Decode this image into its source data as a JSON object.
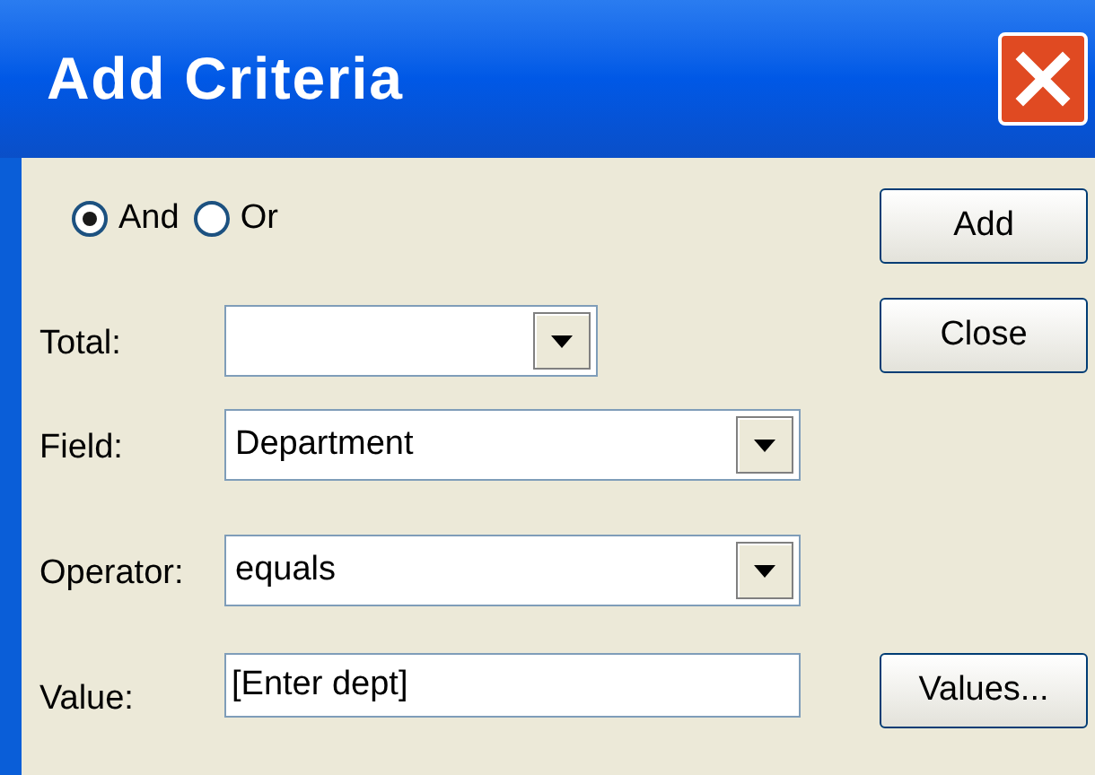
{
  "window": {
    "title": "Add Criteria"
  },
  "logic": [
    {
      "label": "And",
      "selected": true
    },
    {
      "label": "Or",
      "selected": false
    }
  ],
  "fields": [
    {
      "kind": "short-combo",
      "label": "Total:"
    },
    {
      "kind": "combo",
      "label": "Field:",
      "value": "Department"
    },
    {
      "kind": "combo",
      "label": "Operator:",
      "value": "equals"
    },
    {
      "kind": "text",
      "label": "Value:",
      "value": "[Enter dept]"
    }
  ],
  "buttons": [
    "Add",
    "Close",
    "Values..."
  ]
}
